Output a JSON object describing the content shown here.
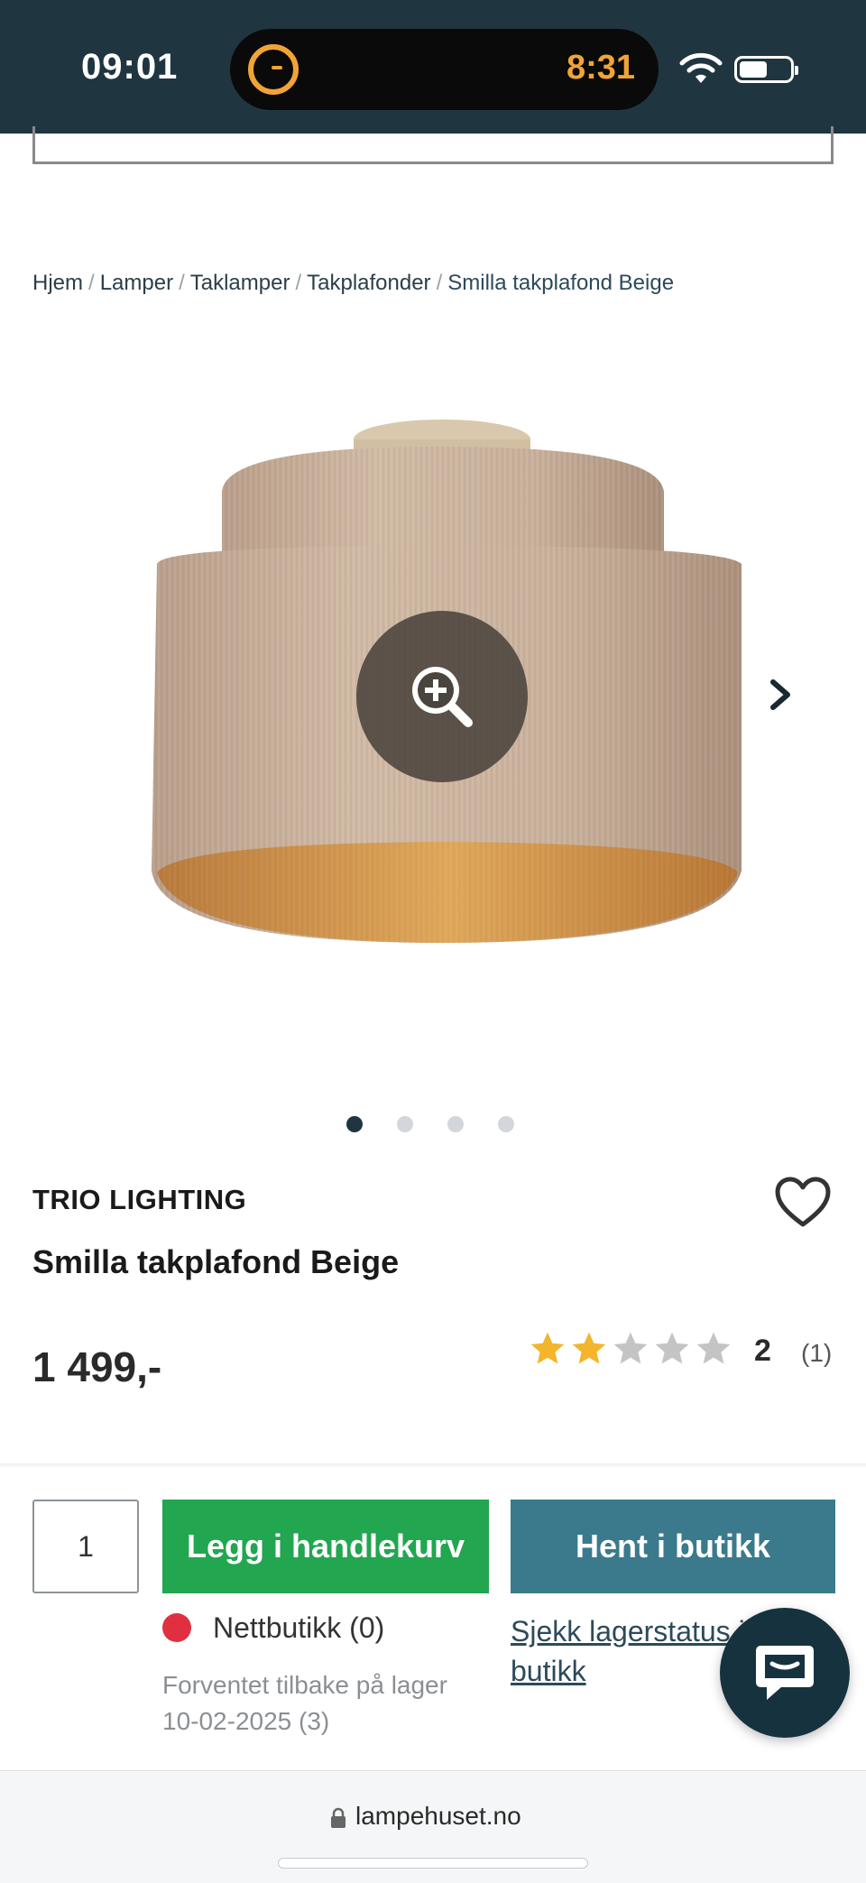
{
  "status_bar": {
    "time_left": "09:01",
    "island_time": "8:31"
  },
  "breadcrumb": {
    "items": [
      "Hjem",
      "Lamper",
      "Taklamper",
      "Takplafonder"
    ],
    "current": "Smilla takplafond Beige",
    "separator": "/"
  },
  "gallery": {
    "image_count": 4,
    "active_index": 0,
    "zoom_icon": "zoom-in-icon",
    "next_icon": "chevron-right-icon"
  },
  "product": {
    "brand": "TRIO LIGHTING",
    "title": "Smilla takplafond Beige",
    "price": "1 499,-",
    "rating": {
      "stars_filled": 2,
      "stars_total": 5,
      "value": "2",
      "count": "(1)"
    }
  },
  "purchase": {
    "quantity": "1",
    "add_to_cart_label": "Legg i handlekurv",
    "pickup_label": "Hent i butikk",
    "online_stock_label": "Nettbutikk (0)",
    "restock_line1": "Forventet tilbake på lager",
    "restock_line2": "10-02-2025 (3)",
    "check_stock_line1": "Sjekk lagerstatus i",
    "check_stock_line2": "butikk"
  },
  "browser": {
    "url": "lampehuset.no"
  },
  "colors": {
    "header_bg": "#1f3641",
    "add_to_cart": "#22a650",
    "pickup": "#3a7a8c",
    "out_of_stock": "#e0303f",
    "star_filled": "#f2b52b",
    "star_empty": "#c4c4c4"
  }
}
